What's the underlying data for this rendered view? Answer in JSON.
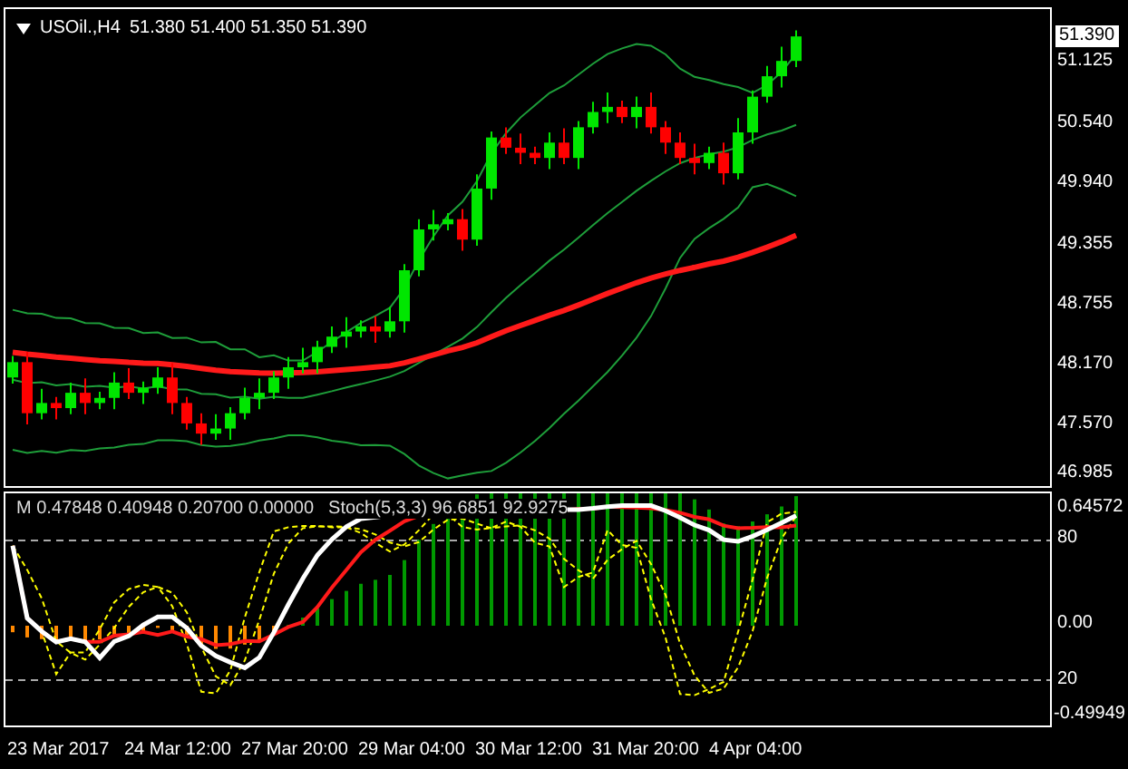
{
  "chart": {
    "symbol": "USOil.,H4",
    "ohlc": "51.380 51.400 51.350 51.390",
    "current_price": "51.390",
    "price_axis": [
      "51.125",
      "50.540",
      "49.940",
      "49.355",
      "48.755",
      "48.170",
      "47.570",
      "46.985"
    ],
    "indicator_values": "M 0.47848 0.40948 0.20700 0.00000",
    "stoch_values": "Stoch(5,3,3) 96.6851 92.9275",
    "indicator_axis": [
      "0.64572",
      "80",
      "0.00",
      "20",
      "-0.49949"
    ],
    "time_axis": [
      "23 Mar 2017",
      "24 Mar 12:00",
      "27 Mar 20:00",
      "29 Mar 04:00",
      "30 Mar 12:00",
      "31 Mar 20:00",
      "4 Apr 04:00"
    ]
  }
}
